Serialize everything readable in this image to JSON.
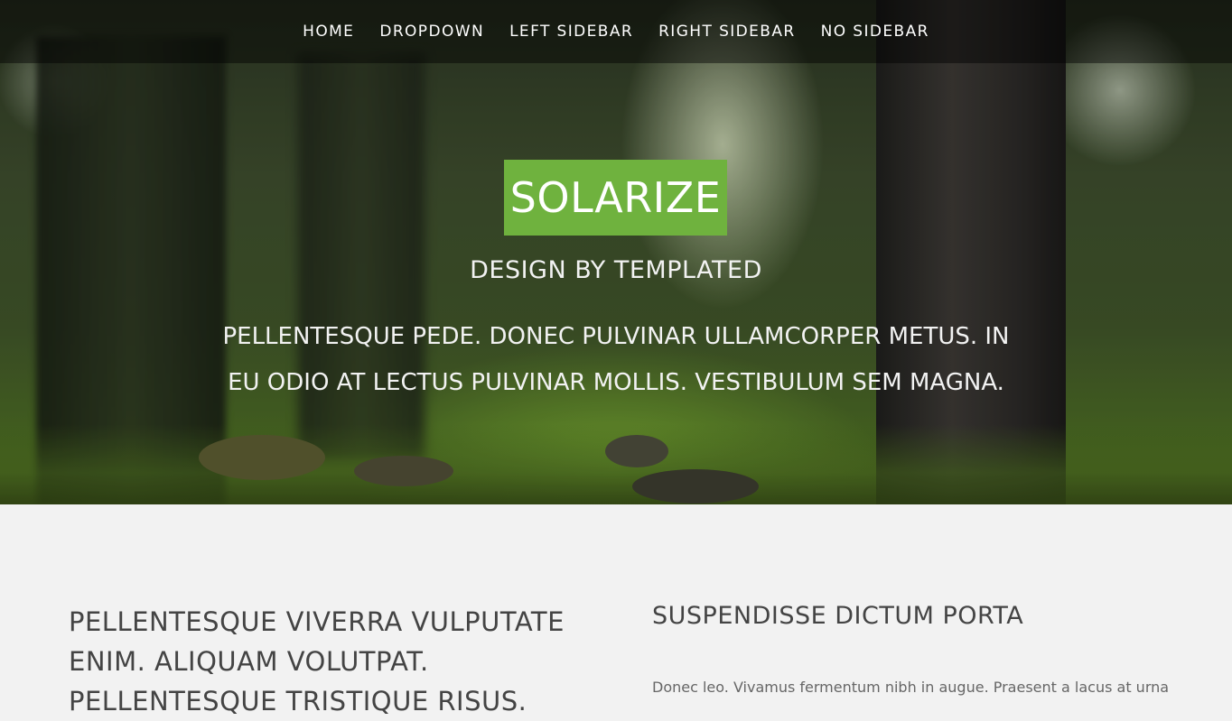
{
  "nav": {
    "items": [
      {
        "label": "HOME"
      },
      {
        "label": "DROPDOWN"
      },
      {
        "label": "LEFT SIDEBAR"
      },
      {
        "label": "RIGHT SIDEBAR"
      },
      {
        "label": "NO SIDEBAR"
      }
    ]
  },
  "hero": {
    "brand": "SOLARIZE",
    "byline": "DESIGN BY TEMPLATED",
    "tagline": "PELLENTESQUE PEDE. DONEC PULVINAR ULLAMCORPER METUS. IN EU ODIO AT LECTUS PULVINAR MOLLIS. VESTIBULUM SEM MAGNA."
  },
  "main": {
    "left_heading": "PELLENTESQUE VIVERRA VULPUTATE ENIM. ALIQUAM VOLUTPAT. PELLENTESQUE TRISTIQUE RISUS.",
    "right_heading": "SUSPENDISSE DICTUM PORTA",
    "right_text": "Donec leo. Vivamus fermentum nibh in augue. Praesent a lacus at urna"
  },
  "colors": {
    "accent": "#6fb23e",
    "nav_background": "rgba(0,0,0,0.45)",
    "content_background": "#f2f2f2"
  }
}
